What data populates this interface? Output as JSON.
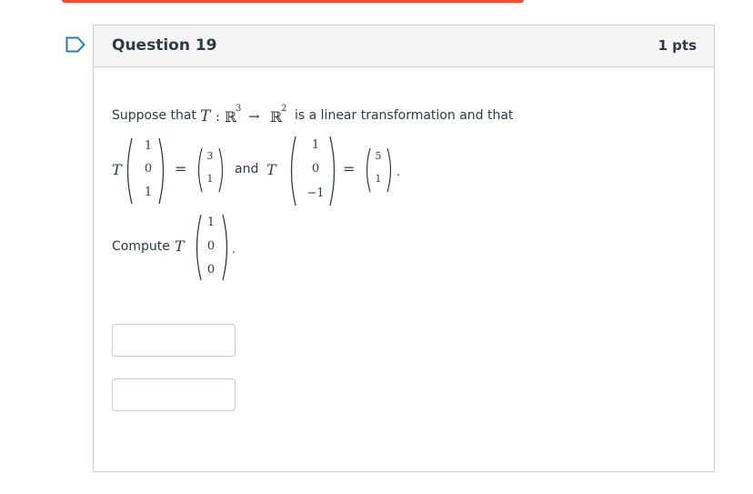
{
  "question": {
    "title": "Question 19",
    "points": "1 pts"
  },
  "statement": {
    "intro": "Suppose that",
    "map_T": "T",
    "map_colon": ":",
    "domain": "ℝ",
    "domain_exp": "3",
    "arrow": "→",
    "codomain": "ℝ",
    "codomain_exp": "2",
    "suffix": "is a linear transformation and that"
  },
  "equation1": {
    "T": "T",
    "input": [
      "1",
      "0",
      "1"
    ],
    "equals": "=",
    "output": [
      "3",
      "1"
    ]
  },
  "connector": "and",
  "equation2": {
    "T": "T",
    "input": [
      "1",
      "0",
      "−1"
    ],
    "equals": "=",
    "output": [
      "5",
      "1"
    ],
    "period": "."
  },
  "compute": {
    "label": "Compute",
    "T": "T",
    "vector": [
      "1",
      "0",
      "0"
    ],
    "period": "."
  },
  "answers": [
    {
      "value": ""
    },
    {
      "value": ""
    }
  ],
  "colors": {
    "top_bar": "#ef4e34",
    "flag": "#2b7abc",
    "border": "#c7cdd1",
    "header_bg": "#f5f5f5",
    "text": "#2d3b45"
  },
  "icons": {
    "flag": "flag-outline-icon"
  }
}
